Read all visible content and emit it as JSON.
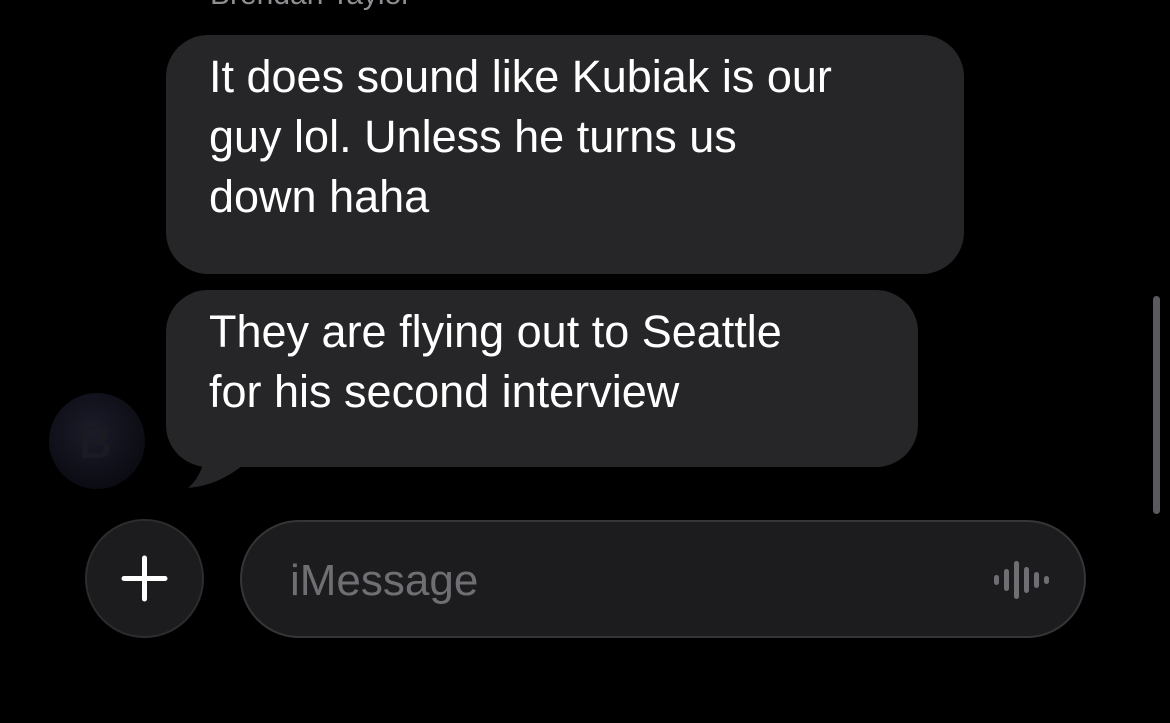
{
  "conversation": {
    "sender_name": "Brendan Taylor",
    "avatar_initial": "B",
    "messages": [
      {
        "direction": "incoming",
        "lines": [
          "It does sound like Kubiak is our",
          "guy lol. Unless he turns us",
          "down haha"
        ]
      },
      {
        "direction": "incoming",
        "lines": [
          "They are flying out to Seattle",
          "for his second interview"
        ]
      }
    ]
  },
  "composer": {
    "plus_icon": "plus-icon",
    "placeholder": "iMessage",
    "voice_icon": "audio-waveform-icon"
  },
  "colors": {
    "background": "#000000",
    "incoming_bubble": "#262628",
    "bubble_text": "#ffffff",
    "placeholder_text": "#6e6e73"
  }
}
